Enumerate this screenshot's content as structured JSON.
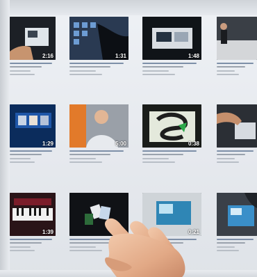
{
  "screen": {
    "rows": [
      [
        {
          "id": "r1c1",
          "duration": "2:16",
          "theme": "hand-tablet"
        },
        {
          "id": "r1c2",
          "duration": "1:31",
          "theme": "touch-apps"
        },
        {
          "id": "r1c3",
          "duration": "1:48",
          "theme": "device-desk"
        },
        {
          "id": "r1c4",
          "duration": "",
          "theme": "people-car"
        }
      ],
      [
        {
          "id": "r2c1",
          "duration": "1:29",
          "theme": "blue-panel"
        },
        {
          "id": "r2c2",
          "duration": "5:00",
          "theme": "presenter"
        },
        {
          "id": "r2c3",
          "duration": "0:38",
          "theme": "green-logo"
        },
        {
          "id": "r2c4",
          "duration": "",
          "theme": "hand-device"
        }
      ],
      [
        {
          "id": "r3c1",
          "duration": "1:39",
          "theme": "keyboard"
        },
        {
          "id": "r3c2",
          "duration": "",
          "theme": "cards"
        },
        {
          "id": "r3c3",
          "duration": "0:21",
          "theme": "tabletop"
        },
        {
          "id": "r3c4",
          "duration": "",
          "theme": "screen-blue"
        }
      ]
    ]
  },
  "colors": {
    "screen_bg": "#e9ecf0",
    "meta_text": "#9aa2ad",
    "skin": "#e9b898"
  }
}
